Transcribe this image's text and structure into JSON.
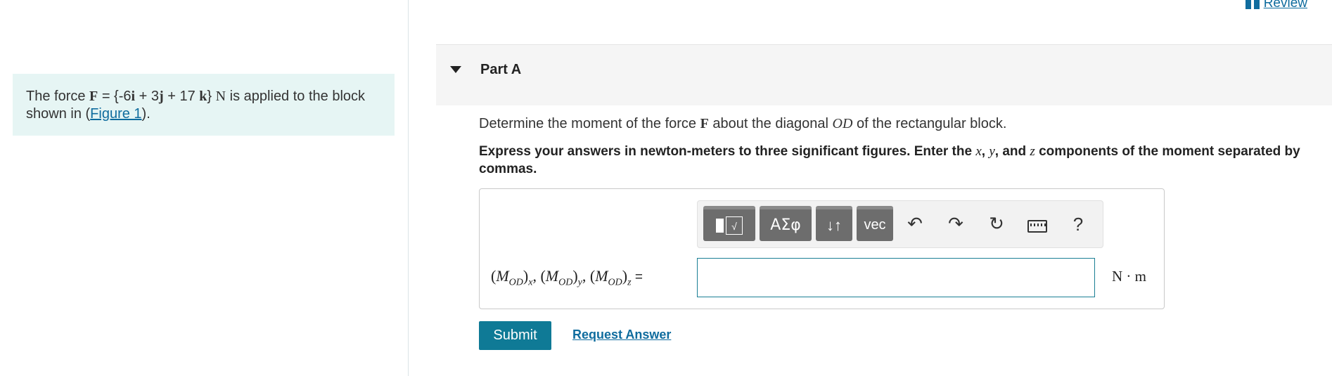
{
  "review": {
    "label": "Review"
  },
  "problem": {
    "text_prefix": "The force ",
    "force_symbol": "F",
    "equals": " = {-6",
    "i": "i",
    "plus3": " + 3",
    "j": "j",
    "plus17": " + 17 ",
    "k": "k",
    "close": "} ",
    "unit": "N",
    "text_suffix": " is applied to the block shown in (",
    "figure_link": "Figure 1",
    "end": ")."
  },
  "part": {
    "title": "Part A"
  },
  "question": {
    "prefix": "Determine the moment of the force ",
    "force": "F",
    "mid": " about the diagonal ",
    "diagonal": "OD",
    "suffix": " of the rectangular block."
  },
  "instructions": {
    "text1": "Express your answers in newton-meters to three significant figures. Enter the ",
    "x": "x",
    "sep1": ", ",
    "y": "y",
    "sep2": ", and ",
    "z": "z",
    "text2": " components of the moment separated by commas."
  },
  "toolbar": {
    "templates_label": "√",
    "greek_label": "ΑΣφ",
    "updown_label": "↓↑",
    "vec_label": "vec",
    "help_label": "?"
  },
  "answer": {
    "label_M": "M",
    "label_sub": "OD",
    "comp_x": "x",
    "comp_y": "y",
    "comp_z": "z",
    "equals": " =",
    "value": "",
    "unit": "N · m"
  },
  "actions": {
    "submit_label": "Submit",
    "request_label": "Request Answer"
  }
}
